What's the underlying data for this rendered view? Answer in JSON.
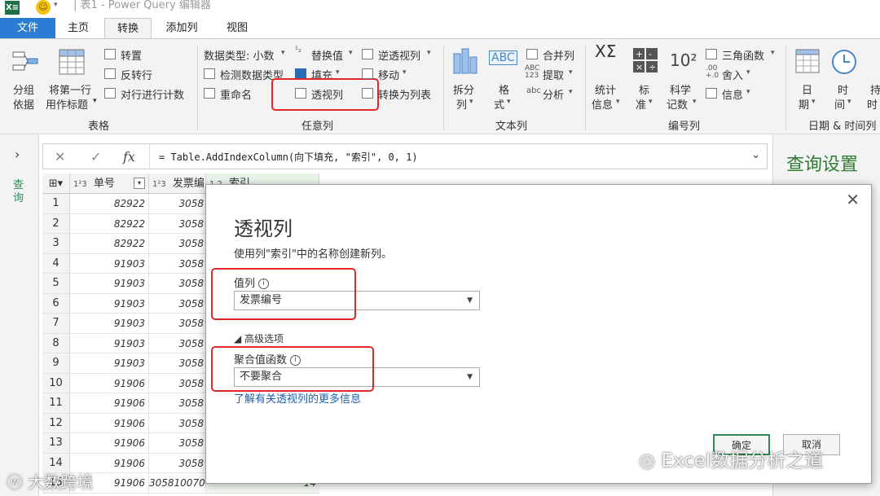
{
  "titlebar": {
    "app_badge": "X≡",
    "title": "| 表1 - Power Query 编辑器"
  },
  "tabs": {
    "file": "文件",
    "home": "主页",
    "transform": "转换",
    "add_column": "添加列",
    "view": "视图"
  },
  "ribbon": {
    "table_group": {
      "label": "表格",
      "group_by": [
        "分组",
        "依据"
      ],
      "use_first_row": [
        "将第一行",
        "用作标题"
      ],
      "transpose": "转置",
      "reverse_rows": "反转行",
      "count_rows": "对行进行计数"
    },
    "any_column_group": {
      "label": "任意列",
      "data_type": "数据类型: 小数",
      "detect_type": "检测数据类型",
      "rename": "重命名",
      "replace_values": "替换值",
      "fill": "填充",
      "pivot_column": "透视列",
      "unpivot": "逆透视列",
      "move": "移动",
      "convert_to_list": "转换为列表"
    },
    "text_group": {
      "label": "文本列",
      "split_column": [
        "拆分",
        "列"
      ],
      "format": [
        "格",
        "式"
      ],
      "merge_columns": "合并列",
      "extract": "提取",
      "parse": "分析"
    },
    "number_group": {
      "label": "编号列",
      "statistics": [
        "统计",
        "信息"
      ],
      "standard": [
        "标",
        "准"
      ],
      "scientific": [
        "科学",
        "记数"
      ],
      "trig": "三角函数",
      "rounding": "舍入",
      "information": "信息"
    },
    "datetime_group": {
      "label": "日期 & 时间列",
      "date": [
        "日",
        "期"
      ],
      "time": [
        "时",
        "间"
      ],
      "duration": [
        "持",
        "时"
      ]
    }
  },
  "formula_bar": {
    "formula": "= Table.AddIndexColumn(向下填充, \"索引\", 0, 1)"
  },
  "left_nav": {
    "label": "查询"
  },
  "right_panel": {
    "title": "查询设置"
  },
  "grid": {
    "columns": [
      {
        "type": "1²3",
        "name": "单号"
      },
      {
        "type": "1²3",
        "name": "发票编"
      },
      {
        "type": "1.2",
        "name": "索引"
      }
    ],
    "rows": [
      {
        "n": "1",
        "c1": "82922",
        "c2": "3058"
      },
      {
        "n": "2",
        "c1": "82922",
        "c2": "3058"
      },
      {
        "n": "3",
        "c1": "82922",
        "c2": "3058"
      },
      {
        "n": "4",
        "c1": "91903",
        "c2": "3058"
      },
      {
        "n": "5",
        "c1": "91903",
        "c2": "3058"
      },
      {
        "n": "6",
        "c1": "91903",
        "c2": "3058"
      },
      {
        "n": "7",
        "c1": "91903",
        "c2": "3058"
      },
      {
        "n": "8",
        "c1": "91903",
        "c2": "3058"
      },
      {
        "n": "9",
        "c1": "91903",
        "c2": "3058"
      },
      {
        "n": "10",
        "c1": "91906",
        "c2": "3058"
      },
      {
        "n": "11",
        "c1": "91906",
        "c2": "3058"
      },
      {
        "n": "12",
        "c1": "91906",
        "c2": "3058"
      },
      {
        "n": "13",
        "c1": "91906",
        "c2": "3058"
      },
      {
        "n": "14",
        "c1": "91906",
        "c2": "3058"
      },
      {
        "n": "15",
        "c1": "91906",
        "c2": "305810070",
        "c3": "14"
      }
    ]
  },
  "dialog": {
    "title": "透视列",
    "description": "使用列\"索引\"中的名称创建新列。",
    "value_column_label": "值列",
    "value_column_selected": "发票编号",
    "advanced_label": "◢ 高级选项",
    "agg_label": "聚合值函数",
    "agg_selected": "不要聚合",
    "learn_more": "了解有关透视列的更多信息",
    "ok": "确定",
    "cancel": "取消"
  },
  "watermarks": {
    "left": "大数跨境",
    "right": "Excel数据分析之道"
  },
  "colors": {
    "file_tab": "#2b7cd3",
    "accent_green": "#2e7d32",
    "highlight_red": "#e0282b",
    "excel_green": "#1e7145"
  }
}
